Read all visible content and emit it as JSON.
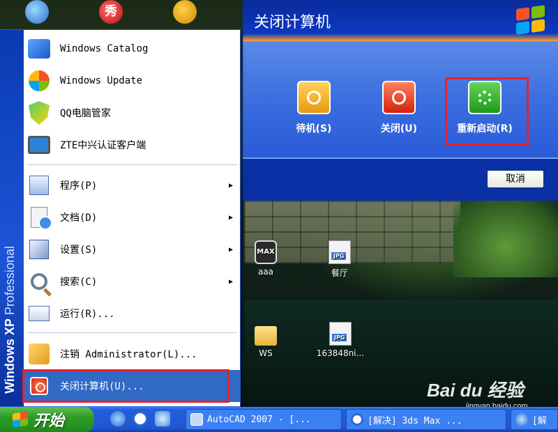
{
  "desktop": {
    "top_icons": [
      "ie-icon",
      "xiu-icon",
      "qq-pet-icon"
    ],
    "top_icon_xiu_text": "秀",
    "icons": [
      {
        "label": "aaa",
        "badge": "MAX"
      },
      {
        "label": "餐厅",
        "badge": "JPG"
      },
      {
        "label": "WS",
        "badge": ""
      },
      {
        "label": "163848ni...",
        "badge": "JPG"
      }
    ]
  },
  "start_menu": {
    "brand_bold": "Windows XP",
    "brand_light": "Professional",
    "pinned": [
      {
        "label": "Windows Catalog",
        "icon": "catalog-icon"
      },
      {
        "label": "Windows Update",
        "icon": "windows-update-icon"
      },
      {
        "label": "QQ电脑管家",
        "icon": "shield-icon"
      },
      {
        "label": "ZTE中兴认证客户端",
        "icon": "monitor-icon"
      }
    ],
    "items": [
      {
        "label": "程序(P)",
        "icon": "programs-icon",
        "submenu": true
      },
      {
        "label": "文档(D)",
        "icon": "documents-icon",
        "submenu": true
      },
      {
        "label": "设置(S)",
        "icon": "settings-icon",
        "submenu": true
      },
      {
        "label": "搜索(C)",
        "icon": "search-icon",
        "submenu": true
      },
      {
        "label": "运行(R)...",
        "icon": "run-icon",
        "submenu": false
      }
    ],
    "logoff": {
      "label": "注销 Administrator(L)...",
      "icon": "logoff-icon"
    },
    "shutdown": {
      "label": "关闭计算机(U)...",
      "icon": "power-icon"
    },
    "arrow": "▶"
  },
  "dialog": {
    "title": "关闭计算机",
    "options": [
      {
        "label": "待机(S)",
        "icon": "standby-icon"
      },
      {
        "label": "关闭(U)",
        "icon": "power-off-icon"
      },
      {
        "label": "重新启动(R)",
        "icon": "restart-icon"
      }
    ],
    "cancel_label": "取消"
  },
  "taskbar": {
    "start_label": "开始",
    "tasks": [
      {
        "label": "AutoCAD 2007 - [...",
        "icon": "autocad-icon"
      },
      {
        "label": "[解决] 3ds Max ...",
        "icon": "sogou-icon"
      },
      {
        "label": "[解",
        "icon": "ie-icon"
      }
    ]
  },
  "watermark": {
    "main": "Bai du 经验",
    "sub": "jingyan.baidu.com"
  },
  "colors": {
    "highlight": "#e8202c",
    "menu_selected": "#316ac5",
    "xp_blue": "#245edb",
    "start_green": "#2f9d2a"
  }
}
